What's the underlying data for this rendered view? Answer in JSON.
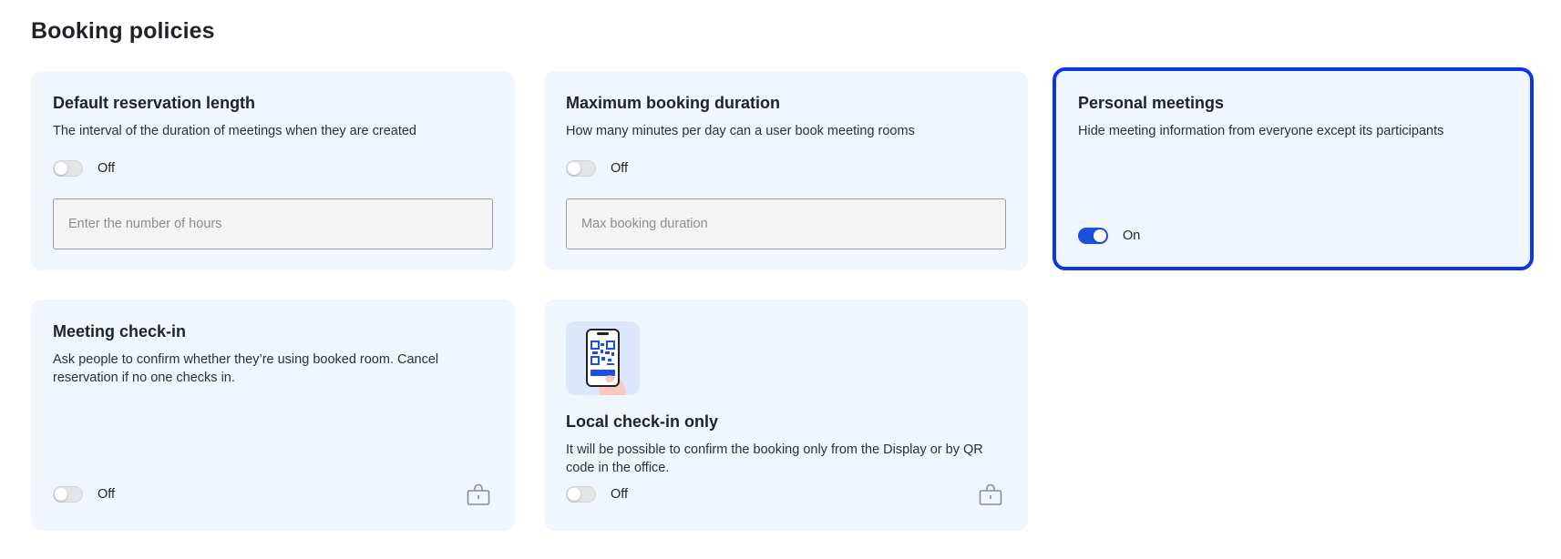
{
  "page": {
    "title": "Booking policies"
  },
  "colors": {
    "accent": "#1a4fe0",
    "card_bg": "#f1f5fd",
    "highlight": "#0a35e8"
  },
  "cards": {
    "default_length": {
      "title": "Default reservation length",
      "description": "The interval of the duration of meetings when they are created",
      "toggle_label": "Off",
      "toggle_on": false,
      "input_placeholder": "Enter the number of hours",
      "input_value": ""
    },
    "max_duration": {
      "title": "Maximum booking duration",
      "description": "How many minutes per day can a user book meeting rooms",
      "toggle_label": "Off",
      "toggle_on": false,
      "input_placeholder": "Max booking duration",
      "input_value": ""
    },
    "personal_meetings": {
      "title": "Personal meetings",
      "description": "Hide meeting information from everyone except its participants",
      "toggle_label": "On",
      "toggle_on": true
    },
    "meeting_checkin": {
      "title": "Meeting check-in",
      "description": "Ask people to confirm whether they’re using booked room. Cancel reservation if no one checks in.",
      "toggle_label": "Off",
      "toggle_on": false,
      "icon": "lock-icon"
    },
    "local_checkin": {
      "title": "Local check-in only",
      "description": "It will be possible to confirm the booking only from the Display or by QR code in the office.",
      "toggle_label": "Off",
      "toggle_on": false,
      "icon": "lock-icon",
      "illustration": "phone-qr-illustration"
    }
  }
}
